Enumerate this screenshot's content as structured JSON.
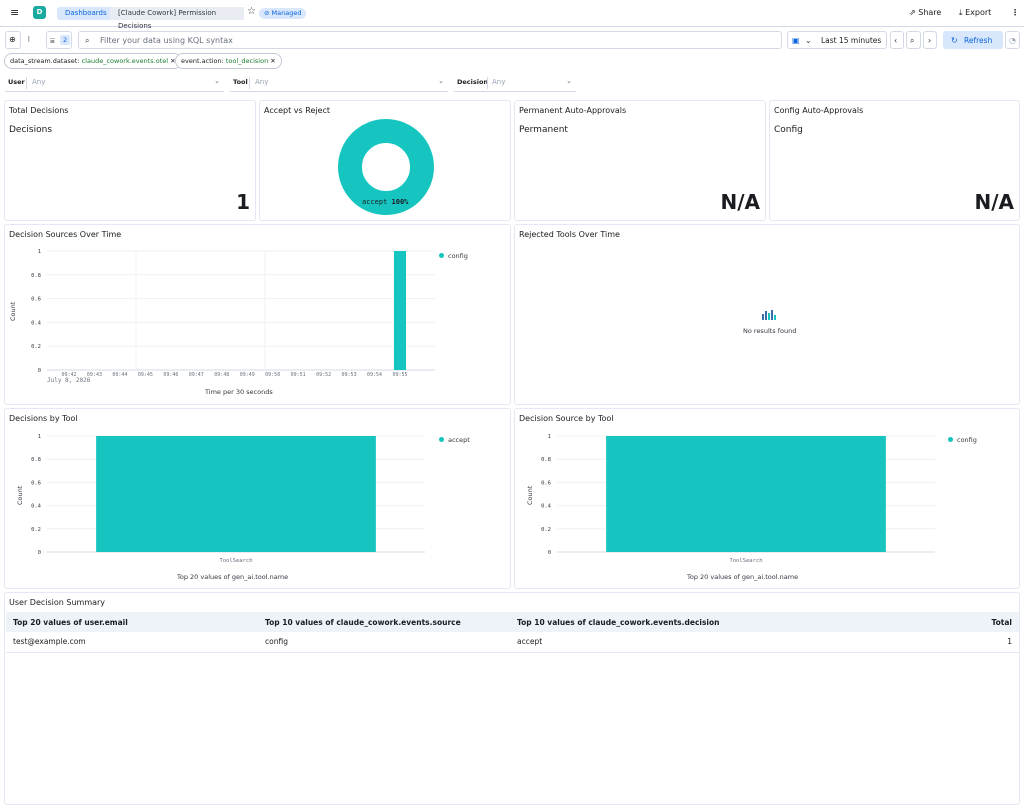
{
  "header": {
    "logo_letter": "D",
    "breadcrumbs": [
      "Dashboards",
      "[Claude Cowork] Permission Decisions"
    ],
    "managed_badge": "Managed",
    "share_label": "Share",
    "export_label": "Export"
  },
  "query": {
    "filter_count": "2",
    "placeholder": "Filter your data using KQL syntax",
    "time_range": "Last 15 minutes",
    "refresh_label": "Refresh"
  },
  "filters": [
    {
      "key": "data_stream.dataset:",
      "value": "claude_cowork.events.otel"
    },
    {
      "key": "event.action:",
      "value": "tool_decision"
    }
  ],
  "controls": [
    {
      "label": "User",
      "value": "Any"
    },
    {
      "label": "Tool",
      "value": "Any"
    },
    {
      "label": "Decision",
      "value": "Any"
    }
  ],
  "panels": {
    "total": {
      "title": "Total Decisions",
      "label": "Decisions",
      "value": "1"
    },
    "accept_reject": {
      "title": "Accept vs Reject",
      "slice_label": "accept",
      "slice_pct": "100%"
    },
    "permanent": {
      "title": "Permanent Auto-Approvals",
      "label": "Permanent",
      "value": "N/A"
    },
    "config": {
      "title": "Config Auto-Approvals",
      "label": "Config",
      "value": "N/A"
    },
    "sources_over_time": {
      "title": "Decision Sources Over Time",
      "ylabel": "Count",
      "xlabel": "Time per 30 seconds",
      "date_label": "July 8, 2026",
      "legend": "config"
    },
    "rejected_over_time": {
      "title": "Rejected Tools Over Time",
      "empty": "No results found"
    },
    "by_tool": {
      "title": "Decisions by Tool",
      "ylabel": "Count",
      "xlabel": "Top 20 values of gen_ai.tool.name",
      "legend": "accept"
    },
    "source_by_tool": {
      "title": "Decision Source by Tool",
      "ylabel": "Count",
      "xlabel": "Top 20 values of gen_ai.tool.name",
      "legend": "config"
    }
  },
  "summary": {
    "title": "User Decision Summary",
    "columns": [
      "Top 20 values of user.email",
      "Top 10 values of claude_cowork.events.source",
      "Top 10 values of claude_cowork.events.decision",
      "Total"
    ],
    "rows": [
      [
        "test@example.com",
        "config",
        "accept",
        "1"
      ]
    ]
  },
  "colors": {
    "series": "#16c5c0",
    "accent": "#0b64dd"
  },
  "chart_data": [
    {
      "type": "pie",
      "labels": [
        "accept"
      ],
      "values": [
        100
      ],
      "donut": true
    },
    {
      "type": "bar",
      "x": [
        "09:42",
        "09:43",
        "09:44",
        "09:45",
        "09:46",
        "09:47",
        "09:48",
        "09:49",
        "09:50",
        "09:51",
        "09:52",
        "09:53",
        "09:54",
        "09:55"
      ],
      "series": [
        {
          "name": "config",
          "values": [
            0,
            0,
            0,
            0,
            0,
            0,
            0,
            0,
            0,
            0,
            0,
            0,
            0,
            1
          ]
        }
      ],
      "yticks": [
        "0",
        "0.2",
        "0.4",
        "0.6",
        "0.8",
        "1"
      ],
      "ylim": [
        0,
        1
      ],
      "xlabel": "Time per 30 seconds",
      "ylabel": "Count",
      "legend": "top-right"
    },
    {
      "type": "bar",
      "categories": [
        "ToolSearch"
      ],
      "series": [
        {
          "name": "accept",
          "values": [
            1
          ]
        }
      ],
      "yticks": [
        "0",
        "0.2",
        "0.4",
        "0.6",
        "0.8",
        "1"
      ],
      "ylim": [
        0,
        1
      ],
      "xlabel": "Top 20 values of gen_ai.tool.name",
      "ylabel": "Count",
      "legend": "top-right"
    },
    {
      "type": "bar",
      "categories": [
        "ToolSearch"
      ],
      "series": [
        {
          "name": "config",
          "values": [
            1
          ]
        }
      ],
      "yticks": [
        "0",
        "0.2",
        "0.4",
        "0.6",
        "0.8",
        "1"
      ],
      "ylim": [
        0,
        1
      ],
      "xlabel": "Top 20 values of gen_ai.tool.name",
      "ylabel": "Count",
      "legend": "top-right"
    }
  ]
}
